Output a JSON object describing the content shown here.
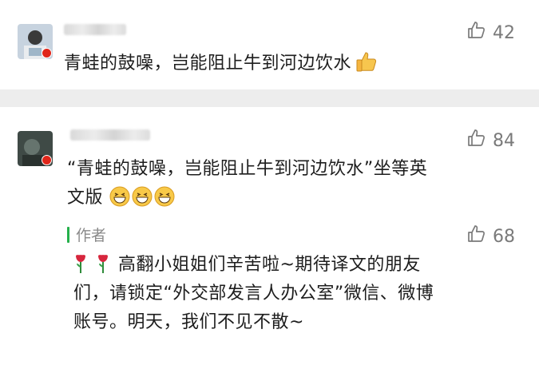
{
  "comments": [
    {
      "text": "青蛙的鼓噪，岂能阻止牛到河边饮水",
      "emoji": "thumbs-up",
      "likes": "42"
    },
    {
      "text_line1": "“青蛙的鼓噪，岂能阻止牛到河边饮水”坐等英",
      "text_line2": "文版",
      "emoji": "grinning-face",
      "likes": "84",
      "reply": {
        "author_label": "作者",
        "likes": "68",
        "line1": "高翻小姐姐们辛苦啦~期待译文的朋友",
        "line2": "们，请锁定“外交部发言人办公室”微信、微博",
        "line3": "账号。明天，我们不见不散~",
        "emoji": "rose"
      }
    }
  ],
  "colors": {
    "author_bar": "#25b04b",
    "flag": "#e0261a",
    "like_gray": "#7a7a7a",
    "divider_bg": "#ededed"
  },
  "icons": [
    "thumb-up-outline-icon",
    "thumbs-up-emoji",
    "grin-emoji",
    "rose-emoji",
    "china-flag-badge"
  ]
}
